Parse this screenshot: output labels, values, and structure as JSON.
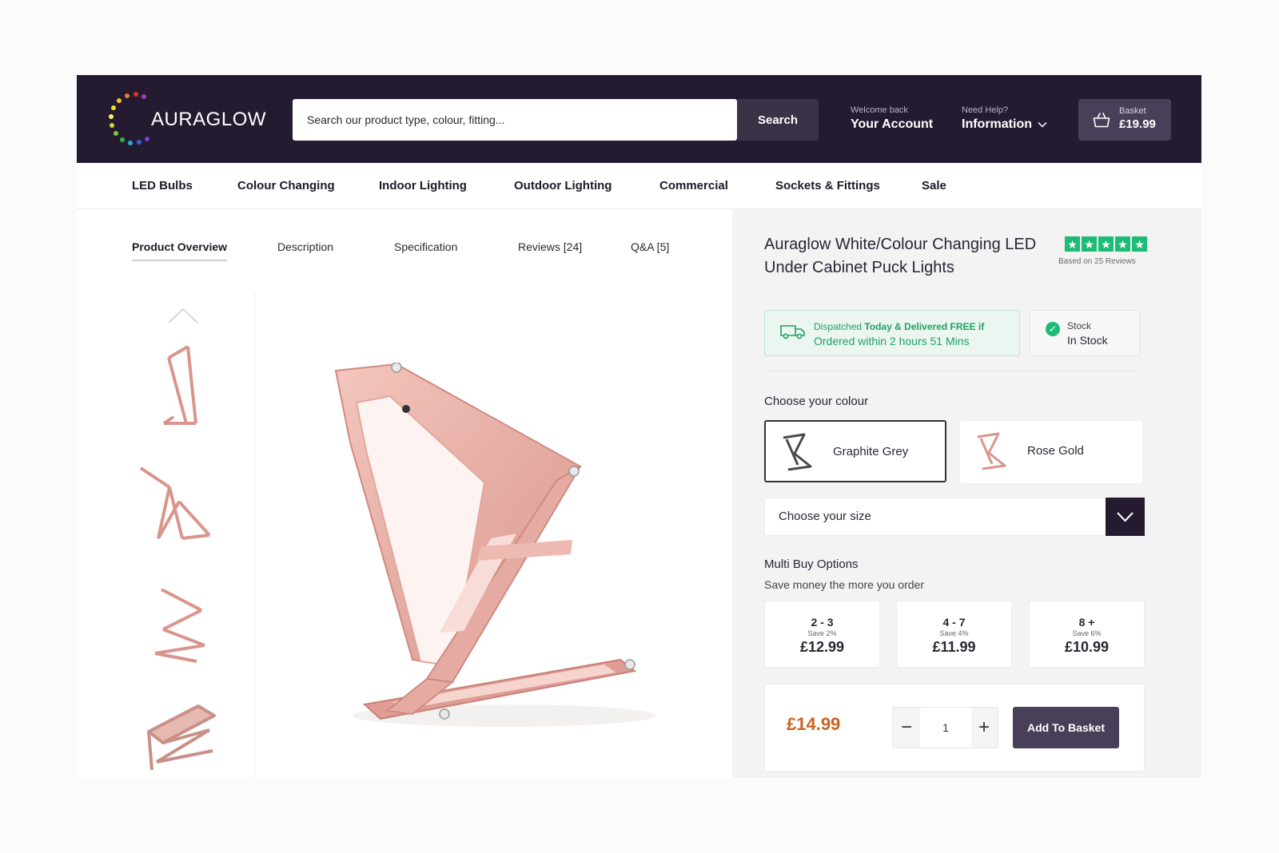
{
  "brand": {
    "logo_text": "AURAGLOW"
  },
  "header": {
    "search_placeholder": "Search our product type, colour, fitting...",
    "search_button": "Search",
    "account_small": "Welcome back",
    "account_big": "Your Account",
    "help_small": "Need Help?",
    "help_big": "Information",
    "basket_small": "Basket",
    "basket_total": "£19.99"
  },
  "nav": [
    "LED Bulbs",
    "Colour Changing",
    "Indoor Lighting",
    "Outdoor Lighting",
    "Commercial",
    "Sockets & Fittings",
    "Sale"
  ],
  "tabs": [
    "Product Overview",
    "Description",
    "Specification",
    "Reviews [24]",
    "Q&A [5]"
  ],
  "product": {
    "title": "Auraglow White/Colour Changing LED Under Cabinet Puck Lights",
    "rating_stars": 5,
    "review_note": "Based on 25 Reviews"
  },
  "dispatch": {
    "label_a": "Dispatched",
    "label_b": "Today & Delivered FREE if",
    "line2": "Ordered within 2 hours 51 Mins"
  },
  "stock": {
    "label": "Stock",
    "value": "In Stock"
  },
  "colour": {
    "heading": "Choose your colour",
    "options": [
      "Graphite Grey",
      "Rose Gold"
    ],
    "selected": "Graphite Grey"
  },
  "size": {
    "placeholder": "Choose your size"
  },
  "multibuy": {
    "heading": "Multi Buy Options",
    "subheading": "Save money the more you order",
    "options": [
      {
        "qty": "2 - 3",
        "save": "Save 2%",
        "price": "£12.99"
      },
      {
        "qty": "4 - 7",
        "save": "Save 4%",
        "price": "£11.99"
      },
      {
        "qty": "8 +",
        "save": "Save 6%",
        "price": "£10.99"
      }
    ]
  },
  "buy": {
    "price": "£14.99",
    "quantity": "1",
    "minus": "−",
    "plus": "+",
    "add_label": "Add To Basket"
  },
  "colors": {
    "header_bg": "#241b31",
    "accent": "#4a3f59",
    "price": "#c8651f",
    "trust_green": "#1dbc76",
    "product_pink": "#e7aaa2"
  }
}
